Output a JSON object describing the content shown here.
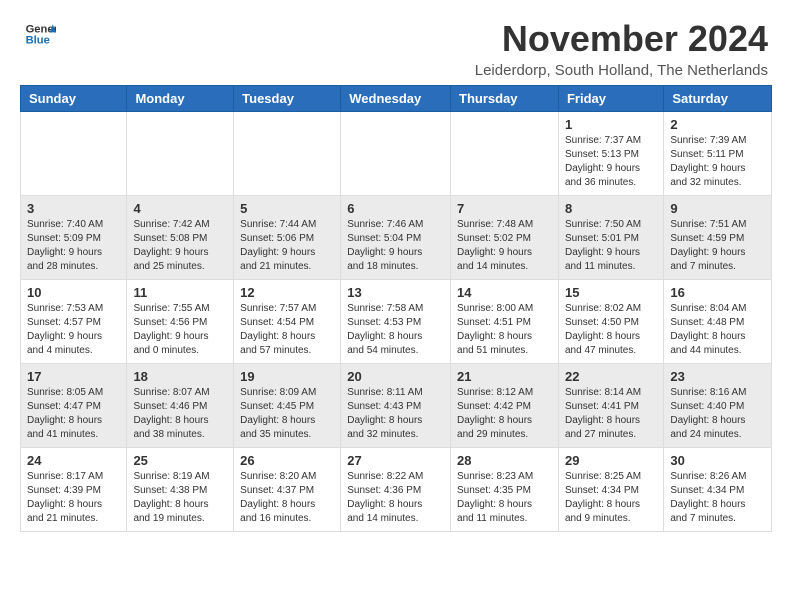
{
  "header": {
    "logo_line1": "General",
    "logo_line2": "Blue",
    "month_title": "November 2024",
    "location": "Leiderdorp, South Holland, The Netherlands"
  },
  "weekdays": [
    "Sunday",
    "Monday",
    "Tuesday",
    "Wednesday",
    "Thursday",
    "Friday",
    "Saturday"
  ],
  "weeks": [
    [
      {
        "day": "",
        "info": ""
      },
      {
        "day": "",
        "info": ""
      },
      {
        "day": "",
        "info": ""
      },
      {
        "day": "",
        "info": ""
      },
      {
        "day": "",
        "info": ""
      },
      {
        "day": "1",
        "info": "Sunrise: 7:37 AM\nSunset: 5:13 PM\nDaylight: 9 hours\nand 36 minutes."
      },
      {
        "day": "2",
        "info": "Sunrise: 7:39 AM\nSunset: 5:11 PM\nDaylight: 9 hours\nand 32 minutes."
      }
    ],
    [
      {
        "day": "3",
        "info": "Sunrise: 7:40 AM\nSunset: 5:09 PM\nDaylight: 9 hours\nand 28 minutes."
      },
      {
        "day": "4",
        "info": "Sunrise: 7:42 AM\nSunset: 5:08 PM\nDaylight: 9 hours\nand 25 minutes."
      },
      {
        "day": "5",
        "info": "Sunrise: 7:44 AM\nSunset: 5:06 PM\nDaylight: 9 hours\nand 21 minutes."
      },
      {
        "day": "6",
        "info": "Sunrise: 7:46 AM\nSunset: 5:04 PM\nDaylight: 9 hours\nand 18 minutes."
      },
      {
        "day": "7",
        "info": "Sunrise: 7:48 AM\nSunset: 5:02 PM\nDaylight: 9 hours\nand 14 minutes."
      },
      {
        "day": "8",
        "info": "Sunrise: 7:50 AM\nSunset: 5:01 PM\nDaylight: 9 hours\nand 11 minutes."
      },
      {
        "day": "9",
        "info": "Sunrise: 7:51 AM\nSunset: 4:59 PM\nDaylight: 9 hours\nand 7 minutes."
      }
    ],
    [
      {
        "day": "10",
        "info": "Sunrise: 7:53 AM\nSunset: 4:57 PM\nDaylight: 9 hours\nand 4 minutes."
      },
      {
        "day": "11",
        "info": "Sunrise: 7:55 AM\nSunset: 4:56 PM\nDaylight: 9 hours\nand 0 minutes."
      },
      {
        "day": "12",
        "info": "Sunrise: 7:57 AM\nSunset: 4:54 PM\nDaylight: 8 hours\nand 57 minutes."
      },
      {
        "day": "13",
        "info": "Sunrise: 7:58 AM\nSunset: 4:53 PM\nDaylight: 8 hours\nand 54 minutes."
      },
      {
        "day": "14",
        "info": "Sunrise: 8:00 AM\nSunset: 4:51 PM\nDaylight: 8 hours\nand 51 minutes."
      },
      {
        "day": "15",
        "info": "Sunrise: 8:02 AM\nSunset: 4:50 PM\nDaylight: 8 hours\nand 47 minutes."
      },
      {
        "day": "16",
        "info": "Sunrise: 8:04 AM\nSunset: 4:48 PM\nDaylight: 8 hours\nand 44 minutes."
      }
    ],
    [
      {
        "day": "17",
        "info": "Sunrise: 8:05 AM\nSunset: 4:47 PM\nDaylight: 8 hours\nand 41 minutes."
      },
      {
        "day": "18",
        "info": "Sunrise: 8:07 AM\nSunset: 4:46 PM\nDaylight: 8 hours\nand 38 minutes."
      },
      {
        "day": "19",
        "info": "Sunrise: 8:09 AM\nSunset: 4:45 PM\nDaylight: 8 hours\nand 35 minutes."
      },
      {
        "day": "20",
        "info": "Sunrise: 8:11 AM\nSunset: 4:43 PM\nDaylight: 8 hours\nand 32 minutes."
      },
      {
        "day": "21",
        "info": "Sunrise: 8:12 AM\nSunset: 4:42 PM\nDaylight: 8 hours\nand 29 minutes."
      },
      {
        "day": "22",
        "info": "Sunrise: 8:14 AM\nSunset: 4:41 PM\nDaylight: 8 hours\nand 27 minutes."
      },
      {
        "day": "23",
        "info": "Sunrise: 8:16 AM\nSunset: 4:40 PM\nDaylight: 8 hours\nand 24 minutes."
      }
    ],
    [
      {
        "day": "24",
        "info": "Sunrise: 8:17 AM\nSunset: 4:39 PM\nDaylight: 8 hours\nand 21 minutes."
      },
      {
        "day": "25",
        "info": "Sunrise: 8:19 AM\nSunset: 4:38 PM\nDaylight: 8 hours\nand 19 minutes."
      },
      {
        "day": "26",
        "info": "Sunrise: 8:20 AM\nSunset: 4:37 PM\nDaylight: 8 hours\nand 16 minutes."
      },
      {
        "day": "27",
        "info": "Sunrise: 8:22 AM\nSunset: 4:36 PM\nDaylight: 8 hours\nand 14 minutes."
      },
      {
        "day": "28",
        "info": "Sunrise: 8:23 AM\nSunset: 4:35 PM\nDaylight: 8 hours\nand 11 minutes."
      },
      {
        "day": "29",
        "info": "Sunrise: 8:25 AM\nSunset: 4:34 PM\nDaylight: 8 hours\nand 9 minutes."
      },
      {
        "day": "30",
        "info": "Sunrise: 8:26 AM\nSunset: 4:34 PM\nDaylight: 8 hours\nand 7 minutes."
      }
    ]
  ]
}
